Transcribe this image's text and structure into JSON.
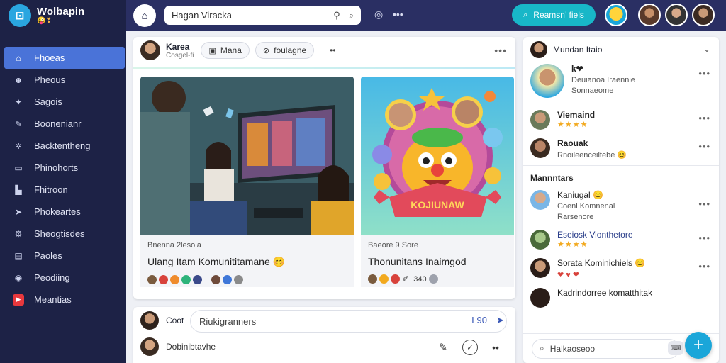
{
  "sidebar": {
    "brand_name": "Wolbapin",
    "brand_sub": "😜❣",
    "items": [
      {
        "label": "Fhoeas",
        "icon": "home-icon"
      },
      {
        "label": "Pheous",
        "icon": "people-icon"
      },
      {
        "label": "Sagois",
        "icon": "star-icon"
      },
      {
        "label": "Boonenianr",
        "icon": "pen-icon"
      },
      {
        "label": "Backtentheng",
        "icon": "gear-icon"
      },
      {
        "label": "Phinohorts",
        "icon": "card-icon"
      },
      {
        "label": "Fhitroon",
        "icon": "book-icon"
      },
      {
        "label": "Phokeartes",
        "icon": "send-icon"
      },
      {
        "label": "Sheogtisdes",
        "icon": "settings-icon"
      },
      {
        "label": "Paoles",
        "icon": "list-icon"
      },
      {
        "label": "Peodiing",
        "icon": "clock-icon"
      },
      {
        "label": "Meantias",
        "icon": "video-icon"
      }
    ]
  },
  "topbar": {
    "search_value": "Hagan Viracka",
    "upgrade_label": "Reamsn’ fiels"
  },
  "post": {
    "author": "Karea",
    "author_sub": "Cosgel-fi",
    "pill1": "Mana",
    "pill2": "foulagne",
    "left": {
      "small": "Bnenna 2lesola",
      "title": "Ulang Itam Komunititamane 😊"
    },
    "right": {
      "small": "Baeore 9 Sore",
      "title": "Thonunitans Inaimgod",
      "count": "340",
      "banner": "KOJIUNAW"
    }
  },
  "composer": {
    "label": "Coot",
    "placeholder": "Riukigranners",
    "count": "L90",
    "desc": "Dobinibtavhe"
  },
  "right_panel": {
    "header": "Mundan Itaio",
    "featured": {
      "name": "k❤",
      "sub1": "Deuianoa Iraennie",
      "sub2": "Sonnaeome"
    },
    "friends": [
      {
        "name": "Viemaind",
        "sub": "★★★★"
      },
      {
        "name": "Raouak",
        "sub": "Rnoileеncеiltebe 😊"
      }
    ],
    "section": "Mannntars",
    "members": [
      {
        "name": "Kaniugal 😊",
        "sub1": "Coenl Komnenal",
        "sub2": "Rarsenore"
      },
      {
        "name": "Eseiosk Vionthetore",
        "sub1": "★★★★"
      },
      {
        "name": "Sorata Kominichiels 😊",
        "sub1": "❤ ♥ ❤"
      },
      {
        "name": "Kadrindorreе komatthitak",
        "sub1": ""
      }
    ],
    "search_placeholder": "Halkaoseoo"
  }
}
